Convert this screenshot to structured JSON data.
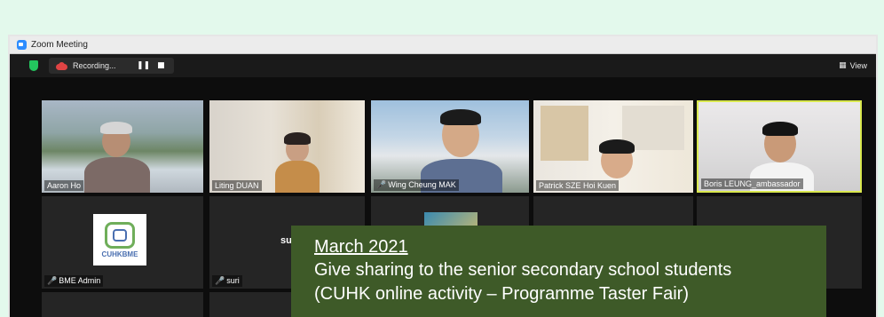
{
  "window": {
    "title": "Zoom Meeting"
  },
  "toolbar": {
    "recording_label": "Recording...",
    "pause_icon": "pause-icon",
    "stop_icon": "stop-icon",
    "view_label": "View"
  },
  "participants": [
    {
      "name": "Aaron Ho",
      "muted": false
    },
    {
      "name": "Liting DUAN",
      "muted": false
    },
    {
      "name": "Wing Cheung MAK",
      "muted": true
    },
    {
      "name": "Patrick SZE Hoi Kuen",
      "muted": false
    },
    {
      "name": "Boris LEUNG_ambassador",
      "muted": false,
      "active_speaker": true
    },
    {
      "name": "BME Admin",
      "muted": true
    },
    {
      "name": "suri",
      "muted": true,
      "center_label": "suri"
    }
  ],
  "bme_logo_text": "CUHKBME",
  "caption": {
    "date": "March 2021",
    "line1": "Give sharing to the senior secondary school students",
    "line2": "(CUHK online activity – Programme Taster Fair)"
  },
  "colors": {
    "background": "#e3f9ec",
    "caption_bg": "#3e5a28",
    "active_speaker_border": "#d9e84e",
    "muted_icon": "#ff3b3b"
  }
}
